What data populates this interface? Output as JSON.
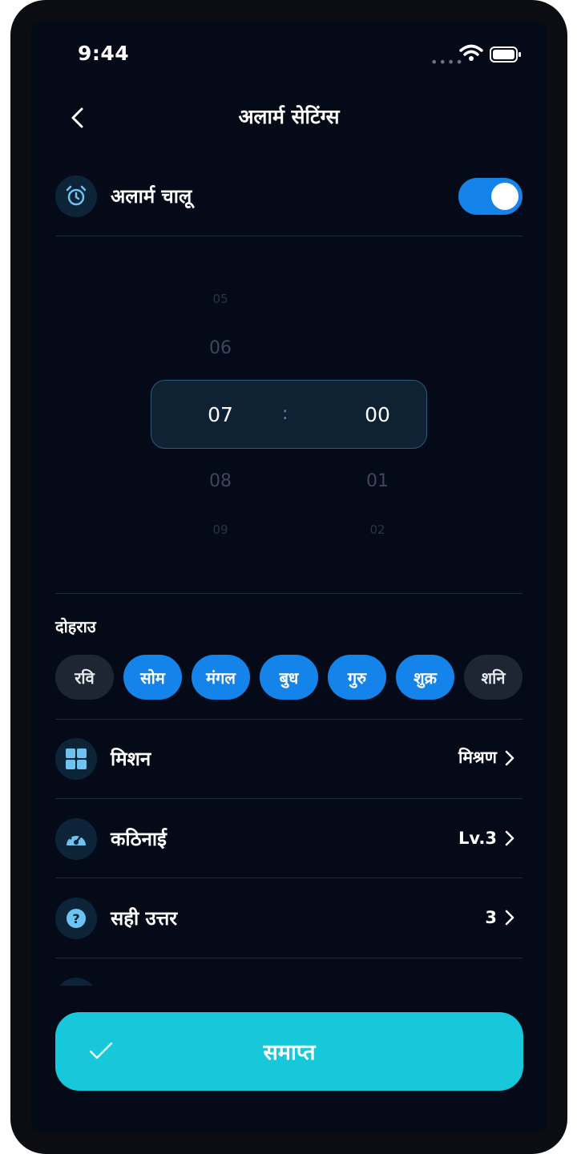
{
  "status": {
    "time": "9:44"
  },
  "header": {
    "title": "अलार्म सेटिंग्स"
  },
  "alarm": {
    "label": "अलार्म चालू",
    "enabled": true
  },
  "time_picker": {
    "hours": {
      "above2": "05",
      "above1": "06",
      "selected": "07",
      "below1": "08",
      "below2": "09"
    },
    "minutes": {
      "selected": "00",
      "below1": "01",
      "below2": "02"
    },
    "separator": ":"
  },
  "repeat": {
    "label": "दोहराउ",
    "days": [
      {
        "label": "रवि",
        "active": false
      },
      {
        "label": "सोम",
        "active": true
      },
      {
        "label": "मंगल",
        "active": true
      },
      {
        "label": "बुध",
        "active": true
      },
      {
        "label": "गुरु",
        "active": true
      },
      {
        "label": "शुक्र",
        "active": true
      },
      {
        "label": "शनि",
        "active": false
      }
    ]
  },
  "settings": [
    {
      "label": "मिशन",
      "value": "मिश्रण",
      "icon": "grid-icon"
    },
    {
      "label": "कठिनाई",
      "value": "Lv.3",
      "icon": "gauge-icon"
    },
    {
      "label": "सही उत्तर",
      "value": "3",
      "icon": "question-icon"
    }
  ],
  "done_button": {
    "label": "समाप्त"
  },
  "colors": {
    "accent": "#1584ea",
    "done": "#16c8da",
    "background": "#040a18"
  }
}
